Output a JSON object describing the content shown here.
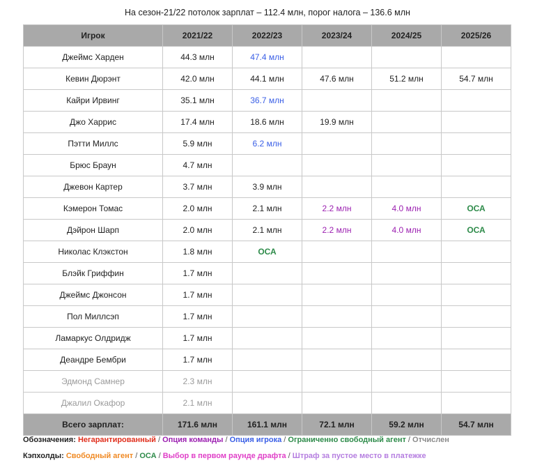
{
  "caption": "На сезон-21/22 потолок зарплат – 112.4 млн, порог налога – 136.6 млн",
  "table": {
    "headers": [
      "Игрок",
      "2021/22",
      "2022/23",
      "2023/24",
      "2024/25",
      "2025/26"
    ],
    "rows": [
      {
        "player": "Джеймс Харден",
        "inactive": false,
        "cells": [
          {
            "v": "44.3 млн",
            "s": ""
          },
          {
            "v": "47.4 млн",
            "s": "player"
          },
          {
            "v": "",
            "s": ""
          },
          {
            "v": "",
            "s": ""
          },
          {
            "v": "",
            "s": ""
          }
        ]
      },
      {
        "player": "Кевин Дюрэнт",
        "inactive": false,
        "cells": [
          {
            "v": "42.0 млн",
            "s": ""
          },
          {
            "v": "44.1 млн",
            "s": ""
          },
          {
            "v": "47.6 млн",
            "s": ""
          },
          {
            "v": "51.2 млн",
            "s": ""
          },
          {
            "v": "54.7 млн",
            "s": ""
          }
        ]
      },
      {
        "player": "Кайри Ирвинг",
        "inactive": false,
        "cells": [
          {
            "v": "35.1 млн",
            "s": ""
          },
          {
            "v": "36.7 млн",
            "s": "player"
          },
          {
            "v": "",
            "s": ""
          },
          {
            "v": "",
            "s": ""
          },
          {
            "v": "",
            "s": ""
          }
        ]
      },
      {
        "player": "Джо Харрис",
        "inactive": false,
        "cells": [
          {
            "v": "17.4 млн",
            "s": ""
          },
          {
            "v": "18.6 млн",
            "s": ""
          },
          {
            "v": "19.9 млн",
            "s": ""
          },
          {
            "v": "",
            "s": ""
          },
          {
            "v": "",
            "s": ""
          }
        ]
      },
      {
        "player": "Пэтти Миллс",
        "inactive": false,
        "cells": [
          {
            "v": "5.9 млн",
            "s": ""
          },
          {
            "v": "6.2 млн",
            "s": "player"
          },
          {
            "v": "",
            "s": ""
          },
          {
            "v": "",
            "s": ""
          },
          {
            "v": "",
            "s": ""
          }
        ]
      },
      {
        "player": "Брюс Браун",
        "inactive": false,
        "cells": [
          {
            "v": "4.7 млн",
            "s": ""
          },
          {
            "v": "",
            "s": ""
          },
          {
            "v": "",
            "s": ""
          },
          {
            "v": "",
            "s": ""
          },
          {
            "v": "",
            "s": ""
          }
        ]
      },
      {
        "player": "Джевон Картер",
        "inactive": false,
        "cells": [
          {
            "v": "3.7 млн",
            "s": ""
          },
          {
            "v": "3.9 млн",
            "s": ""
          },
          {
            "v": "",
            "s": ""
          },
          {
            "v": "",
            "s": ""
          },
          {
            "v": "",
            "s": ""
          }
        ]
      },
      {
        "player": "Кэмерон Томас",
        "inactive": false,
        "cells": [
          {
            "v": "2.0 млн",
            "s": ""
          },
          {
            "v": "2.1 млн",
            "s": ""
          },
          {
            "v": "2.2 млн",
            "s": "team"
          },
          {
            "v": "4.0 млн",
            "s": "team"
          },
          {
            "v": "ОСА",
            "s": "rfa"
          }
        ]
      },
      {
        "player": "Дэйрон Шарп",
        "inactive": false,
        "cells": [
          {
            "v": "2.0 млн",
            "s": ""
          },
          {
            "v": "2.1 млн",
            "s": ""
          },
          {
            "v": "2.2 млн",
            "s": "team"
          },
          {
            "v": "4.0 млн",
            "s": "team"
          },
          {
            "v": "ОСА",
            "s": "rfa"
          }
        ]
      },
      {
        "player": "Николас Клэкстон",
        "inactive": false,
        "cells": [
          {
            "v": "1.8 млн",
            "s": ""
          },
          {
            "v": "ОСА",
            "s": "rfa"
          },
          {
            "v": "",
            "s": ""
          },
          {
            "v": "",
            "s": ""
          },
          {
            "v": "",
            "s": ""
          }
        ]
      },
      {
        "player": "Блэйк Гриффин",
        "inactive": false,
        "cells": [
          {
            "v": "1.7 млн",
            "s": ""
          },
          {
            "v": "",
            "s": ""
          },
          {
            "v": "",
            "s": ""
          },
          {
            "v": "",
            "s": ""
          },
          {
            "v": "",
            "s": ""
          }
        ]
      },
      {
        "player": "Джеймс Джонсон",
        "inactive": false,
        "cells": [
          {
            "v": "1.7 млн",
            "s": ""
          },
          {
            "v": "",
            "s": ""
          },
          {
            "v": "",
            "s": ""
          },
          {
            "v": "",
            "s": ""
          },
          {
            "v": "",
            "s": ""
          }
        ]
      },
      {
        "player": "Пол Миллсэп",
        "inactive": false,
        "cells": [
          {
            "v": "1.7 млн",
            "s": ""
          },
          {
            "v": "",
            "s": ""
          },
          {
            "v": "",
            "s": ""
          },
          {
            "v": "",
            "s": ""
          },
          {
            "v": "",
            "s": ""
          }
        ]
      },
      {
        "player": "Ламаркус Олдридж",
        "inactive": false,
        "cells": [
          {
            "v": "1.7 млн",
            "s": ""
          },
          {
            "v": "",
            "s": ""
          },
          {
            "v": "",
            "s": ""
          },
          {
            "v": "",
            "s": ""
          },
          {
            "v": "",
            "s": ""
          }
        ]
      },
      {
        "player": "Деандре Бембри",
        "inactive": false,
        "cells": [
          {
            "v": "1.7 млн",
            "s": ""
          },
          {
            "v": "",
            "s": ""
          },
          {
            "v": "",
            "s": ""
          },
          {
            "v": "",
            "s": ""
          },
          {
            "v": "",
            "s": ""
          }
        ]
      },
      {
        "player": "Эдмонд Самнер",
        "inactive": true,
        "cells": [
          {
            "v": "2.3 млн",
            "s": ""
          },
          {
            "v": "",
            "s": ""
          },
          {
            "v": "",
            "s": ""
          },
          {
            "v": "",
            "s": ""
          },
          {
            "v": "",
            "s": ""
          }
        ]
      },
      {
        "player": "Джалил Окафор",
        "inactive": true,
        "cells": [
          {
            "v": "2.1 млн",
            "s": ""
          },
          {
            "v": "",
            "s": ""
          },
          {
            "v": "",
            "s": ""
          },
          {
            "v": "",
            "s": ""
          },
          {
            "v": "",
            "s": ""
          }
        ]
      }
    ],
    "totals": {
      "label": "Всего зарплат:",
      "values": [
        "171.6 млн",
        "161.1 млн",
        "72.1 млн",
        "59.2 млн",
        "54.7 млн"
      ]
    }
  },
  "legend": {
    "notation_label": "Обозначения:",
    "notation_items": [
      {
        "text": "Негарантированный",
        "s": "nonguar"
      },
      {
        "text": "Опция команды",
        "s": "team"
      },
      {
        "text": "Опция игрока",
        "s": "player"
      },
      {
        "text": "Ограниченно свободный агент",
        "s": "rfa"
      },
      {
        "text": "Отчислен",
        "s": "waived"
      }
    ],
    "caps_label": "Кэпхолды:",
    "caps_items": [
      {
        "text": "Свободный агент",
        "s": "ufa"
      },
      {
        "text": "ОСА",
        "s": "rfa"
      },
      {
        "text": "Выбор в первом раунде драфта",
        "s": "draft"
      },
      {
        "text": "Штраф за пустое место в платежке",
        "s": "dead"
      }
    ],
    "separator": "/"
  },
  "colors": {
    "header_bg": "#a9a9a9",
    "non_guaranteed": "#e0301e",
    "team_option": "#9b1fb0",
    "player_option": "#3a5fe6",
    "restricted_fa": "#2e8b4a",
    "waived": "#8a8a8a",
    "free_agent": "#f08a24",
    "draft_pick": "#e040c8",
    "dead_money": "#b57ee0"
  }
}
